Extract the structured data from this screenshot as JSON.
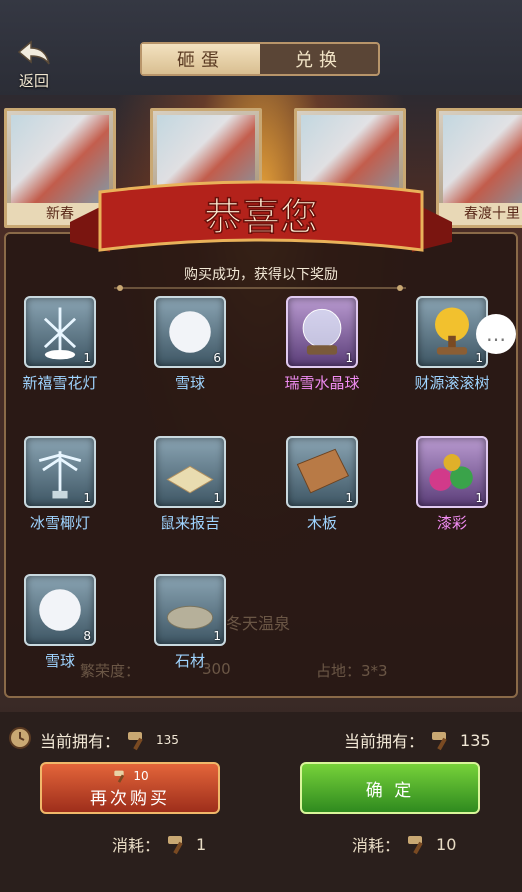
{
  "header": {
    "back_label": "返回",
    "tabs": [
      {
        "label": "砸蛋",
        "active": true
      },
      {
        "label": "兑换",
        "active": false
      }
    ]
  },
  "gallery": {
    "cards": [
      {
        "caption": "新春"
      },
      {
        "caption": ""
      },
      {
        "caption": ""
      },
      {
        "caption": "春渡十里"
      }
    ]
  },
  "modal": {
    "title": "恭喜您",
    "subtitle": "购买成功，获得以下奖励",
    "rewards": [
      {
        "name": "新禧雪花灯",
        "count": "1",
        "icon": "snowflake-lantern-icon",
        "rarity": "blue"
      },
      {
        "name": "雪球",
        "count": "6",
        "icon": "snowball-icon",
        "rarity": "blue"
      },
      {
        "name": "瑞雪水晶球",
        "count": "1",
        "icon": "crystal-ball-icon",
        "rarity": "purple"
      },
      {
        "name": "财源滚滚树",
        "count": "1",
        "icon": "money-tree-icon",
        "rarity": "blue"
      },
      {
        "name": "冰雪椰灯",
        "count": "1",
        "icon": "ice-palm-lamp-icon",
        "rarity": "blue"
      },
      {
        "name": "鼠来报吉",
        "count": "1",
        "icon": "mouse-scroll-icon",
        "rarity": "blue"
      },
      {
        "name": "木板",
        "count": "1",
        "icon": "wood-plank-icon",
        "rarity": "blue"
      },
      {
        "name": "漆彩",
        "count": "1",
        "icon": "paint-bottles-icon",
        "rarity": "purple"
      },
      {
        "name": "雪球",
        "count": "8",
        "icon": "snowball-icon",
        "rarity": "blue"
      },
      {
        "name": "石材",
        "count": "1",
        "icon": "stone-icon",
        "rarity": "blue"
      }
    ],
    "bg_text": {
      "spring_title": "冬天温泉",
      "prosperity_label": "繁荣度：",
      "prosperity_value": "300",
      "area_label": "占地：3*3"
    }
  },
  "bottom": {
    "left_owned_label": "当前拥有：",
    "left_owned_value": "135",
    "right_owned_label": "当前拥有：",
    "right_owned_value": "135",
    "buy_cost_badge": "10",
    "buy_again_label": "再次购买",
    "confirm_label": "确  定",
    "left_cost_label": "消耗：",
    "left_cost_value": "1",
    "right_cost_label": "消耗：",
    "right_cost_value": "10"
  },
  "colors": {
    "blue_item_name": "#9fd4ff",
    "purple_item_name": "#f08cf2",
    "ribbon_red": "#b3221b",
    "confirm_green": "#3fa524",
    "buy_orange": "#c9441f"
  }
}
